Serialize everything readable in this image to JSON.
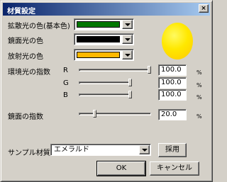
{
  "window": {
    "title": "材質設定",
    "close_glyph": "×"
  },
  "colors": {
    "diffuse": "#007700",
    "specular": "#000000",
    "emissive": "#ffb800",
    "title_start": "#0a246a",
    "title_end": "#a6caf0",
    "preview_sphere": "#ffe800"
  },
  "labels": {
    "diffuse": "拡散光の色(基本色)",
    "specular": "鏡面光の色",
    "emissive": "放射光の色",
    "ambient": "環境光の指数",
    "r": "R",
    "g": "G",
    "b": "B",
    "shininess": "鏡面の指数",
    "sample_material": "サンプル材質"
  },
  "ambient": {
    "r": {
      "value": "100.0",
      "unit": "%",
      "level": 1.0
    },
    "g": {
      "value": "100.0",
      "unit": "%",
      "level": 1.0
    },
    "b": {
      "value": "100.0",
      "unit": "%",
      "level": 1.0
    }
  },
  "shininess": {
    "value": "20.0",
    "unit": "%",
    "level": 0.2
  },
  "sample": {
    "selected": "エメラルド"
  },
  "buttons": {
    "apply": "採用",
    "ok": "OK",
    "cancel": "キャンセル"
  }
}
